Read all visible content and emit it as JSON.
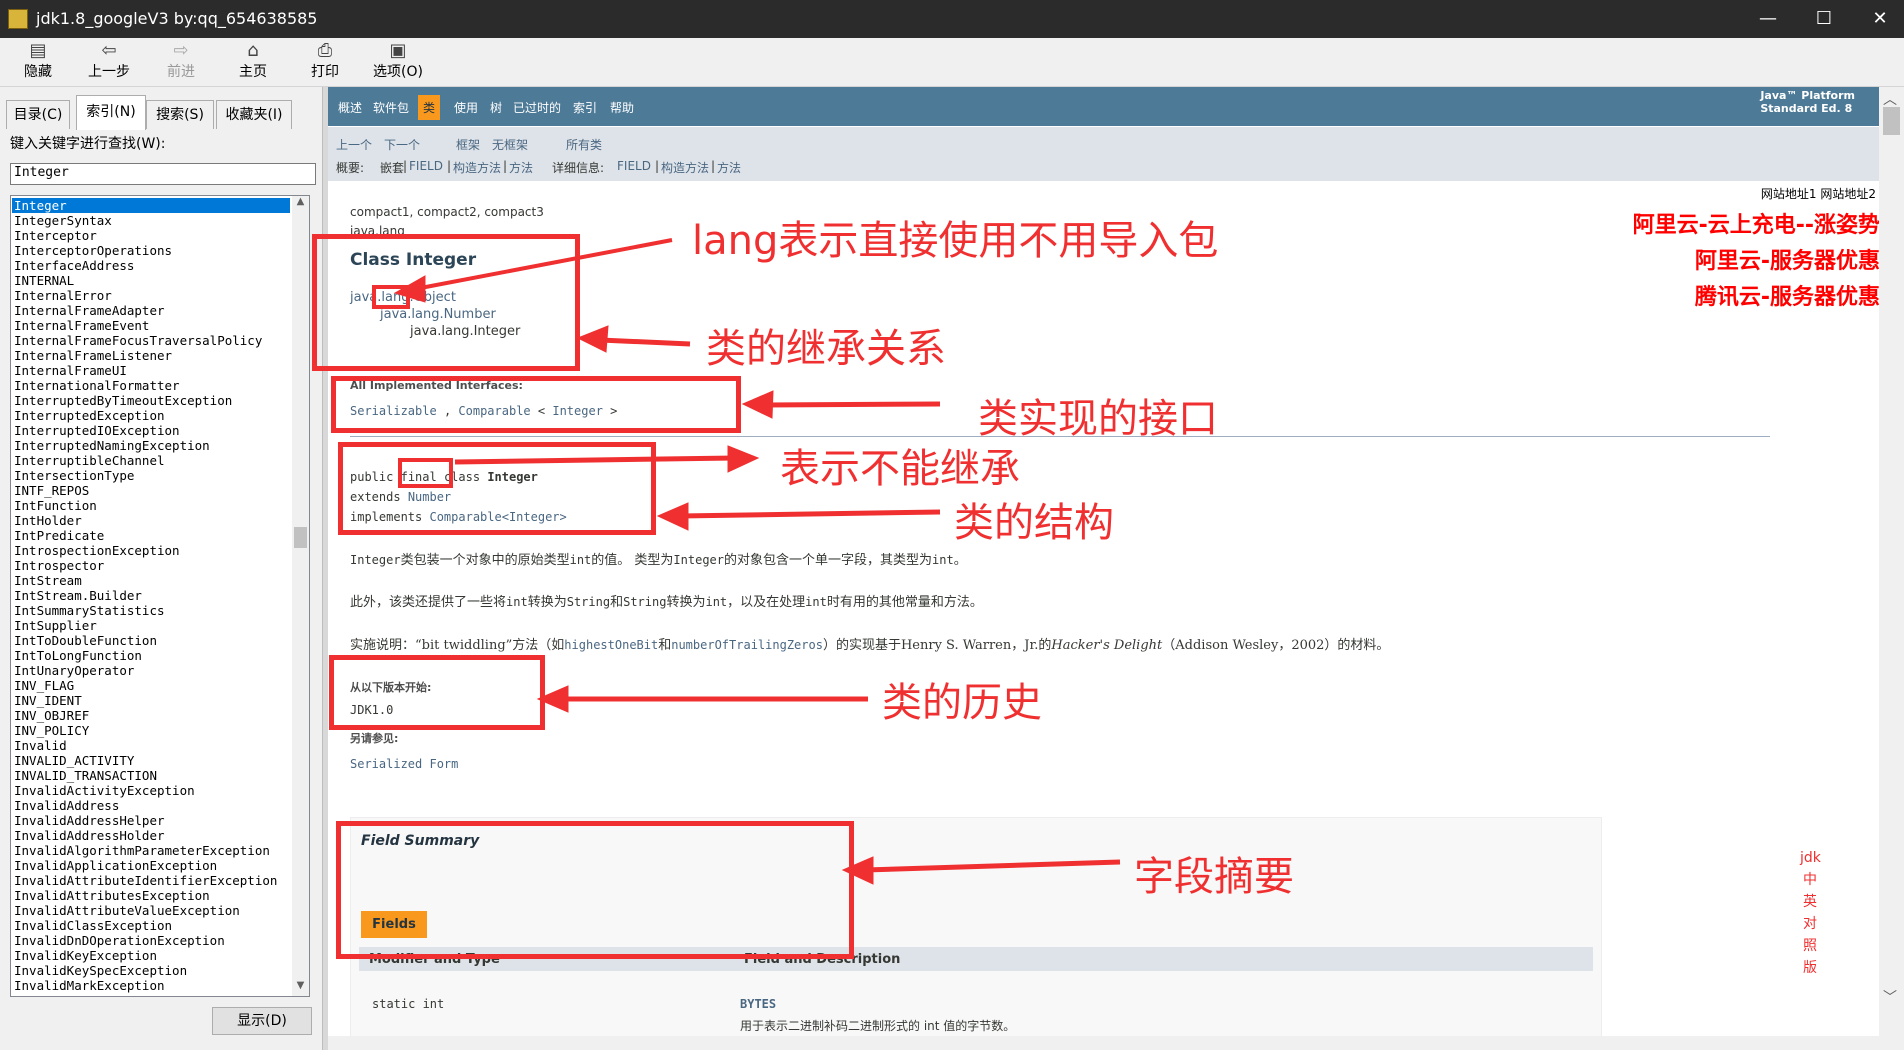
{
  "window": {
    "title": "jdk1.8_googleV3 by:qq_654638585",
    "minimize": "—",
    "maximize": "☐",
    "close": "✕"
  },
  "toolbar": {
    "hide": "隐藏",
    "back": "上一步",
    "forward": "前进",
    "home": "主页",
    "print": "打印",
    "options": "选项(O)"
  },
  "left": {
    "tabs": [
      "目录(C)",
      "索引(N)",
      "搜索(S)",
      "收藏夹(I)"
    ],
    "search_label": "键入关键字进行查找(W):",
    "search_value": "Integer",
    "items": [
      "Integer",
      "IntegerSyntax",
      "Interceptor",
      "InterceptorOperations",
      "InterfaceAddress",
      "INTERNAL",
      "InternalError",
      "InternalFrameAdapter",
      "InternalFrameEvent",
      "InternalFrameFocusTraversalPolicy",
      "InternalFrameListener",
      "InternalFrameUI",
      "InternationalFormatter",
      "InterruptedByTimeoutException",
      "InterruptedException",
      "InterruptedIOException",
      "InterruptedNamingException",
      "InterruptibleChannel",
      "IntersectionType",
      "INTF_REPOS",
      "IntFunction",
      "IntHolder",
      "IntPredicate",
      "IntrospectionException",
      "Introspector",
      "IntStream",
      "IntStream.Builder",
      "IntSummaryStatistics",
      "IntSupplier",
      "IntToDoubleFunction",
      "IntToLongFunction",
      "IntUnaryOperator",
      "INV_FLAG",
      "INV_IDENT",
      "INV_OBJREF",
      "INV_POLICY",
      "Invalid",
      "INVALID_ACTIVITY",
      "INVALID_TRANSACTION",
      "InvalidActivityException",
      "InvalidAddress",
      "InvalidAddressHelper",
      "InvalidAddressHolder",
      "InvalidAlgorithmParameterException",
      "InvalidApplicationException",
      "InvalidAttributeIdentifierException",
      "InvalidAttributesException",
      "InvalidAttributeValueException",
      "InvalidClassException",
      "InvalidDnDOperationException",
      "InvalidKeyException",
      "InvalidKeySpecException",
      "InvalidMarkException"
    ],
    "show_button": "显示(D)"
  },
  "nav": {
    "items": [
      "概述",
      "软件包",
      "类",
      "使用",
      "树",
      "已过时的",
      "索引",
      "帮助"
    ],
    "platform_line1": "Java™ Platform",
    "platform_line2": "Standard Ed. 8",
    "prev": "上一个",
    "next": "下一个",
    "frames": "框架",
    "noframes": "无框架",
    "allclasses": "所有类",
    "summary_label": "概要:",
    "summary_nested": "嵌套",
    "summary_field": "FIELD",
    "summary_constr": "构造方法",
    "summary_method": "方法",
    "detail_label": "详细信息:",
    "detail_field": "FIELD",
    "detail_constr": "构造方法",
    "detail_method": "方法",
    "sep": "|"
  },
  "ads": {
    "site1": "网站地址1",
    "site2": "网站地址2",
    "aliyun_charge": "阿里云-云上充电--涨姿势",
    "aliyun_server": "阿里云-服务器优惠",
    "tencent_server": "腾讯云-服务器优惠",
    "jdk_side": [
      "jdk",
      "中",
      "英",
      "对",
      "照",
      "版"
    ]
  },
  "doc": {
    "profiles": "compact1, compact2, compact3",
    "package": "java.lang",
    "class_title": "Class Integer",
    "inherit_1": "java.lang.Object",
    "inherit_2": "java.lang.Number",
    "inherit_3": "java.lang.Integer",
    "impl_label": "All Implemented Interfaces:",
    "impl_serializable": "Serializable",
    "impl_comma": ",",
    "impl_comparable": "Comparable",
    "impl_lt": "<",
    "impl_integer": "Integer",
    "impl_gt": ">",
    "decl_public": "public",
    "decl_final": "final",
    "decl_class": "class",
    "decl_name": "Integer",
    "decl_extends": "extends",
    "decl_number": "Number",
    "decl_implements": "implements",
    "decl_comparable": "Comparable<Integer>",
    "desc1_a": "Integer",
    "desc1_b": "类包装一个对象中的原始类型",
    "desc1_c": "int",
    "desc1_d": "的值。 类型为",
    "desc1_e": "Integer",
    "desc1_f": "的对象包含一个单一字段，其类型为",
    "desc1_g": "int",
    "desc1_h": "。",
    "desc2_a": "此外，该类还提供了一些将",
    "desc2_b": "int",
    "desc2_c": "转换为",
    "desc2_d": "String",
    "desc2_e": "和",
    "desc2_f": "String",
    "desc2_g": "转换为",
    "desc2_h": "int",
    "desc2_i": "，以及在处理",
    "desc2_j": "int",
    "desc2_k": "时有用的其他常量和方法。",
    "desc3_a": "实施说明：“bit twiddling”方法（如",
    "desc3_b": "highestOneBit",
    "desc3_c": "和",
    "desc3_d": "numberOfTrailingZeros",
    "desc3_e": "）的实现基于Henry S. Warren，Jr.的",
    "desc3_f": "Hacker's Delight",
    "desc3_g": "（Addison Wesley，2002）的材料。",
    "since_label": "从以下版本开始:",
    "since_value": "JDK1.0",
    "see_label": "另请参见:",
    "see_value": "Serialized Form",
    "field_summary": "Field Summary",
    "fields_button": "Fields",
    "col_modifier": "Modifier and Type",
    "col_field": "Field and Description",
    "row1_type": "static int",
    "row1_name": "BYTES",
    "row1_desc": "用于表示二进制补码二进制形式的 int 值的字节数。"
  },
  "annotations": {
    "lang": "lang表示直接使用不用导入包",
    "inherit": "类的继承关系",
    "iface": "类实现的接口",
    "final": "表示不能继承",
    "structure": "类的结构",
    "history": "类的历史",
    "fields": "字段摘要"
  },
  "colors": {
    "nav_bg": "#4d7a97",
    "nav_active": "#f8981d",
    "annotation_red": "#f03030",
    "selection": "#0078d7"
  }
}
